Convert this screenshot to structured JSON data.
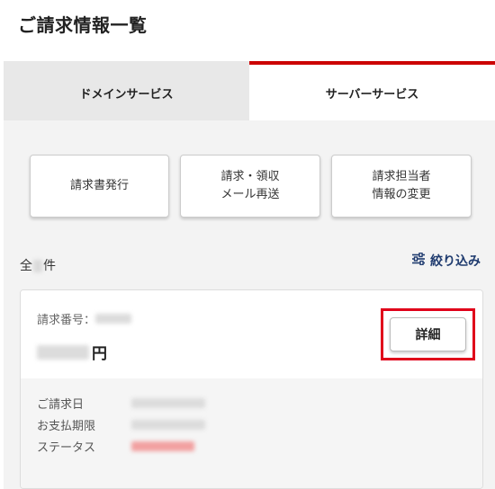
{
  "page": {
    "title": "ご請求情報一覧"
  },
  "tabs": [
    {
      "label": "ドメインサービス",
      "active": false
    },
    {
      "label": "サーバーサービス",
      "active": true
    }
  ],
  "actions": {
    "issue_invoice": "請求書発行",
    "resend_mail_line1": "請求・領収",
    "resend_mail_line2": "メール再送",
    "change_contact_line1": "請求担当者",
    "change_contact_line2": "情報の変更"
  },
  "list": {
    "count_prefix": "全",
    "count_suffix": "件",
    "filter_label": "絞り込み",
    "filter_icon": "sliders-icon"
  },
  "invoice": {
    "number_label": "請求番号：",
    "currency_suffix": "円",
    "detail_button": "詳細",
    "fields": [
      {
        "label": "ご請求日"
      },
      {
        "label": "お支払期限"
      },
      {
        "label": "ステータス"
      }
    ]
  },
  "colors": {
    "accent_red": "#cc0000",
    "highlight_red": "#e0001a",
    "link_navy": "#1e3a6e",
    "status_red": "#e05555"
  }
}
